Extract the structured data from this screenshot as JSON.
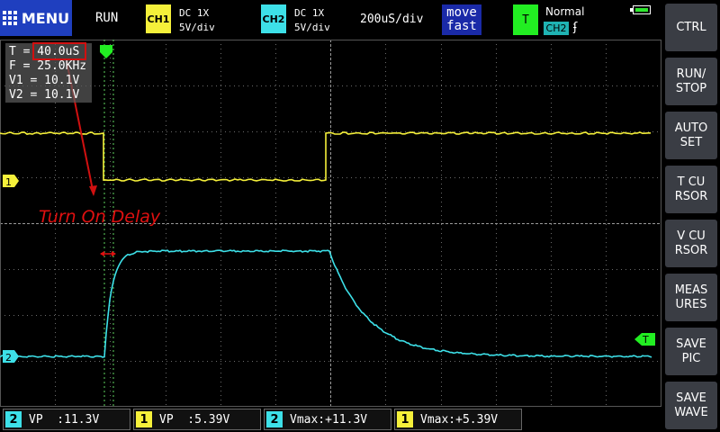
{
  "topbar": {
    "menu_label": "MENU",
    "run_state": "RUN",
    "ch1": {
      "badge": "CH1",
      "coupling": "DC  1X",
      "scale": "5V/div",
      "color": "#f5f03a"
    },
    "ch2": {
      "badge": "CH2",
      "coupling": "DC  1X",
      "scale": "5V/div",
      "color": "#3de0e8"
    },
    "timebase": "200uS/div",
    "move_mode": {
      "line1": "move",
      "line2": "fast"
    },
    "trigger": {
      "badge": "T",
      "mode": "Normal",
      "source": "CH2",
      "edge": "ʄ"
    }
  },
  "readout": {
    "t": "T = 40.0uS",
    "f": "F = 25.0KHz",
    "v1": "V1 = 10.1V",
    "v2": "V2 = 10.1V"
  },
  "annotation": {
    "label": "Turn On Delay",
    "color": "#e01010"
  },
  "markers": {
    "ch1": "1",
    "ch2": "2",
    "trigger": "T"
  },
  "sidebar": {
    "ctrl": "CTRL",
    "run_stop": "RUN/\nSTOP",
    "auto_set": "AUTO\nSET",
    "t_cursor": "T CU\nRSOR",
    "v_cursor": "V CU\nRSOR",
    "measures": "MEAS\nURES",
    "save_pic": "SAVE\nPIC",
    "save_wave": "SAVE\nWAVE"
  },
  "measurements": [
    {
      "ch": "2",
      "text": "VP  :11.3V"
    },
    {
      "ch": "1",
      "text": "VP  :5.39V"
    },
    {
      "ch": "2",
      "text": "Vmax:+11.3V"
    },
    {
      "ch": "1",
      "text": "Vmax:+5.39V"
    }
  ],
  "colors": {
    "ch1": "#f5f03a",
    "ch2": "#3de0e8",
    "grid": "#7a7a7a",
    "cursor": "#5fd35f",
    "accent": "#1f3fbf"
  }
}
